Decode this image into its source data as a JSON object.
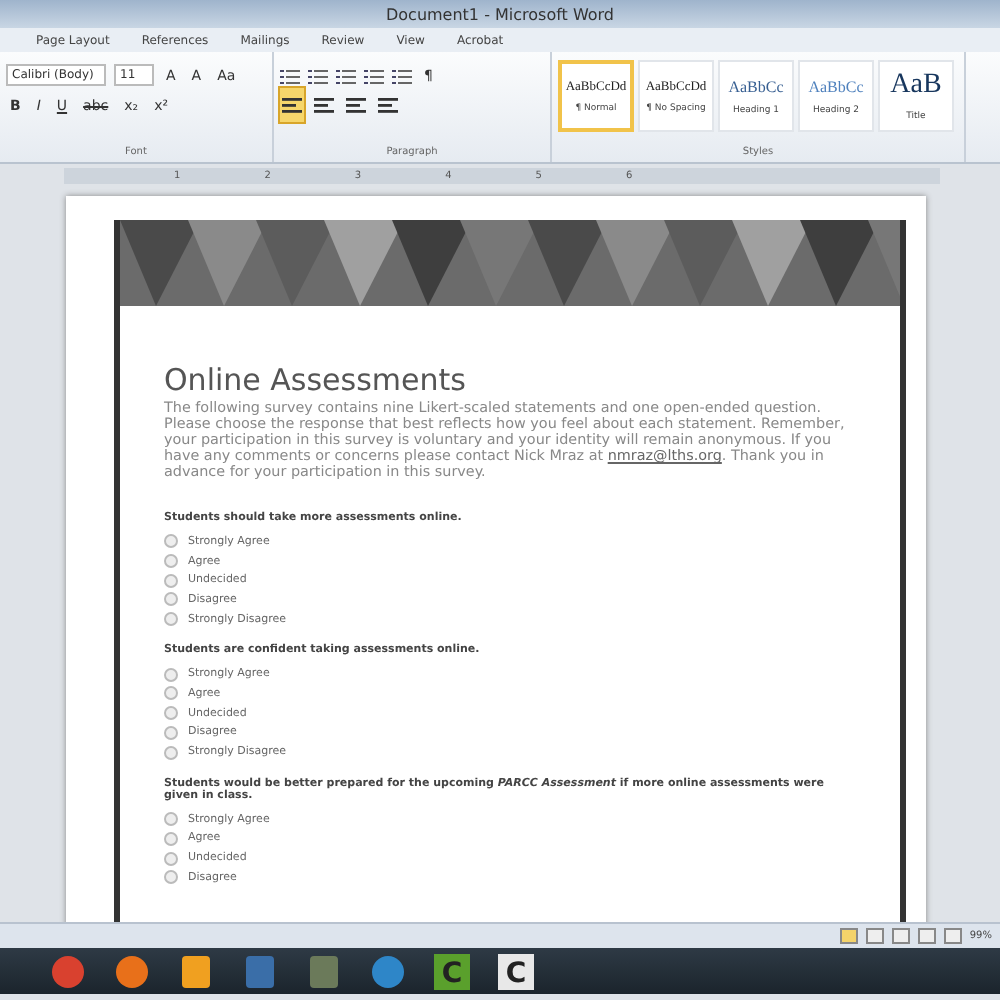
{
  "window": {
    "title": "Document1 - Microsoft Word"
  },
  "tabs": [
    {
      "label": "Page Layout",
      "selected": false
    },
    {
      "label": "References",
      "selected": false
    },
    {
      "label": "Mailings",
      "selected": false
    },
    {
      "label": "Review",
      "selected": false
    },
    {
      "label": "View",
      "selected": false
    },
    {
      "label": "Acrobat",
      "selected": false
    }
  ],
  "font": {
    "name": "Calibri (Body)",
    "size": "11",
    "row1": [
      "A",
      "A",
      "Aa"
    ],
    "row2": [
      "B",
      "I",
      "U",
      "abc",
      "x₂",
      "x²"
    ]
  },
  "paragraph": {
    "pilcrow": "¶",
    "alignments": [
      {
        "selected": true
      },
      {
        "selected": false
      },
      {
        "selected": false
      },
      {
        "selected": false
      }
    ]
  },
  "styles": [
    {
      "sample": "AaBbCcDd",
      "label": "¶ Normal",
      "selected": true,
      "kind": "body"
    },
    {
      "sample": "AaBbCcDd",
      "label": "¶ No Spacing",
      "selected": false,
      "kind": "body"
    },
    {
      "sample": "AaBbCc",
      "label": "Heading 1",
      "selected": false,
      "kind": "heading"
    },
    {
      "sample": "AaBbCc",
      "label": "Heading 2",
      "selected": false,
      "kind": "heading2"
    },
    {
      "sample": "AaB",
      "label": "Title",
      "selected": false,
      "kind": "title"
    }
  ],
  "groups": [
    "Font",
    "Paragraph",
    "Styles"
  ],
  "ruler": [
    "1",
    "2",
    "3",
    "4",
    "5",
    "6"
  ],
  "document": {
    "title": "Online Assessments",
    "intro_before": "The following survey contains nine Likert-scaled statements and one open-ended question. Please choose the response that best reflects how you feel about each statement. Remember, your participation in this survey is voluntary and your identity will remain anonymous. If you have any comments or concerns please contact Nick Mraz at ",
    "email": "nmraz@lths.org",
    "intro_after": ". Thank you in advance for your participation in this survey.",
    "questions": [
      {
        "text": "Students should take more assessments online.",
        "options": [
          {
            "label": "Strongly Agree",
            "selected": false
          },
          {
            "label": "Agree",
            "selected": false
          },
          {
            "label": "Undecided",
            "selected": false
          },
          {
            "label": "Disagree",
            "selected": false
          },
          {
            "label": "Strongly Disagree",
            "selected": false
          }
        ]
      },
      {
        "text": "Students are confident taking assessments online.",
        "options": [
          {
            "label": "Strongly Agree",
            "selected": false
          },
          {
            "label": "Agree",
            "selected": false
          },
          {
            "label": "Undecided",
            "selected": false
          },
          {
            "label": "Disagree",
            "selected": false
          },
          {
            "label": "Strongly Disagree",
            "selected": false
          }
        ]
      },
      {
        "text": "Students would be better prepared for the upcoming *PARCC Assessment* if more online assessments were given in class.",
        "options": [
          {
            "label": "Strongly Agree",
            "selected": false
          },
          {
            "label": "Agree",
            "selected": false
          },
          {
            "label": "Undecided",
            "selected": false
          },
          {
            "label": "Disagree",
            "selected": false
          }
        ]
      }
    ]
  },
  "status_bar": {
    "zoom": "99%"
  },
  "taskbar": [
    {
      "kind": "round",
      "color": "#d9412f"
    },
    {
      "kind": "round",
      "color": "#e8701a"
    },
    {
      "kind": "square",
      "color": "#f0a020"
    },
    {
      "kind": "square",
      "color": "#3a6ea8"
    },
    {
      "kind": "square",
      "color": "#6b7a5a"
    },
    {
      "kind": "round",
      "color": "#2e86c8"
    },
    {
      "kind": "letter",
      "color": "#5aa02c",
      "letter": "C"
    },
    {
      "kind": "letter",
      "color": "#e8e8e8",
      "letter": "C"
    }
  ]
}
